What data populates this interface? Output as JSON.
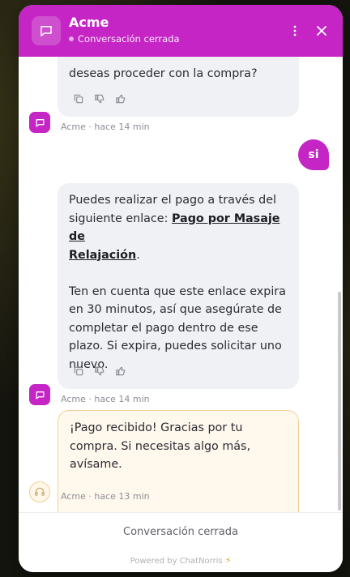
{
  "header": {
    "title": "Acme",
    "status": "Conversación cerrada",
    "color": "#c425c4"
  },
  "messages": {
    "bot1_text": "deseas proceder con la compra?",
    "bot1_meta": "Acme · hace 14 min",
    "user_text": "si",
    "bot2_line1": "Puedes realizar el pago a través del",
    "bot2_line2_prefix": "siguiente enlace: ",
    "bot2_link1": "Pago por Masaje de",
    "bot2_link2": "Relajación",
    "bot2_line3_suffix": ".",
    "bot2_para2": "Ten en cuenta que este enlace expira en 30 minutos, así que asegúrate de completar el pago dentro de ese plazo. Si expira, puedes solicitar uno nuevo.",
    "bot2_meta": "Acme · hace 14 min",
    "agent_text": "¡Pago recibido! Gracias por tu compra. Si necesitas algo más, avísame.",
    "agent_meta": "Acme · hace 13 min"
  },
  "footer": {
    "closed_label": "Conversación cerrada",
    "powered_by": "Powered by ChatNorris"
  },
  "icons": {
    "copy": "copy-icon",
    "dislike": "thumbs-down-icon",
    "like": "thumbs-up-icon",
    "bot": "chat-bubble-icon",
    "agent": "headset-icon"
  }
}
